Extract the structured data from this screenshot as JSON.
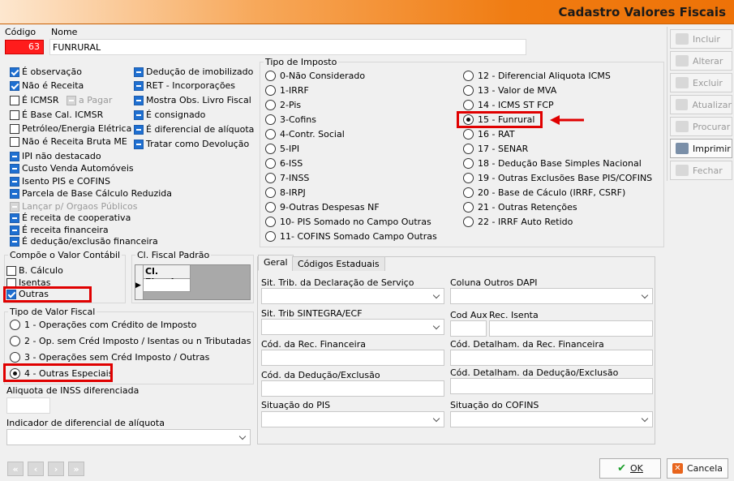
{
  "window": {
    "title": "Cadastro Valores Fiscais"
  },
  "header": {
    "codigo_label": "Código",
    "codigo_value": "63",
    "nome_label": "Nome",
    "nome_value": "FUNRURAL"
  },
  "flags_left": [
    {
      "label": "É observação",
      "state": "checked"
    },
    {
      "label": "Não é Receita",
      "state": "checked"
    },
    {
      "label": "É ICMSR",
      "state": "unchecked"
    },
    {
      "label": "É Base Cal. ICMSR",
      "state": "unchecked"
    },
    {
      "label": "Petróleo/Energia Elétrica",
      "state": "unchecked"
    },
    {
      "label": "Não é Receita Bruta ME",
      "state": "unchecked"
    },
    {
      "label": "IPI não destacado",
      "state": "indeterminate"
    },
    {
      "label": "Custo Venda Automóveis",
      "state": "indeterminate"
    },
    {
      "label": "Isento PIS e COFINS",
      "state": "indeterminate"
    },
    {
      "label": "Parcela de Base Cálculo Reduzida",
      "state": "indeterminate"
    },
    {
      "label": "Lançar p/ Orgaos Públicos",
      "state": "disabled"
    },
    {
      "label": "É receita de cooperativa",
      "state": "indeterminate"
    },
    {
      "label": "É receita financeira",
      "state": "indeterminate"
    },
    {
      "label": "É dedução/exclusão financeira",
      "state": "indeterminate"
    }
  ],
  "a_pagar": {
    "label": "a Pagar"
  },
  "flags_mid": [
    {
      "label": "Dedução de imobilizado"
    },
    {
      "label": "RET - Incorporações"
    },
    {
      "label": "Mostra Obs. Livro Fiscal"
    },
    {
      "label": "É consignado"
    },
    {
      "label": "É diferencial de alíquota"
    },
    {
      "label": "Tratar como Devolução"
    }
  ],
  "tipo_imposto": {
    "title": "Tipo de Imposto",
    "selected": "15 - Funrural",
    "col1": [
      "0-Não Considerado",
      "1-IRRF",
      "2-Pis",
      "3-Cofins",
      "4-Contr. Social",
      "5-IPI",
      "6-ISS",
      "7-INSS",
      "8-IRPJ",
      "9-Outras Despesas NF",
      "10- PIS Somado no Campo Outras",
      "11- COFINS Somado Campo Outras"
    ],
    "col2": [
      "12 - Diferencial Aliquota ICMS",
      "13 - Valor de MVA",
      "14 - ICMS ST FCP",
      "15 - Funrural",
      "16 - RAT",
      "17 - SENAR",
      "18 - Dedução Base Simples Nacional",
      "19 - Outras Exclusões Base PIS/COFINS",
      "20 - Base de Cáculo (IRRF, CSRF)",
      "21 - Outras Retenções",
      "22 - IRRF Auto Retido"
    ]
  },
  "compoe": {
    "title": "Compõe o Valor Contábil",
    "items": [
      {
        "label": "B. Cálculo",
        "state": "unchecked"
      },
      {
        "label": "Isentas",
        "state": "unchecked"
      },
      {
        "label": "Outras",
        "state": "checked"
      }
    ]
  },
  "cl_fiscal": {
    "title": "Cl. Fiscal Padrão",
    "column": "Cl. Fiscal"
  },
  "tipo_valor": {
    "title": "Tipo de Valor Fiscal",
    "selected": "4 - Outras Especiais",
    "options": [
      "1 - Operações com Crédito de Imposto",
      "2 - Op. sem Créd Imposto / Isentas ou n Tributadas",
      "3 - Operações sem Créd Imposto / Outras",
      "4 - Outras Especiais"
    ]
  },
  "aliquota_inss": {
    "label": "Aliquota de INSS diferenciada",
    "value": ""
  },
  "indicador_dif": {
    "label": "Indicador de diferencial de alíquota",
    "value": ""
  },
  "tabs": [
    "Geral",
    "Códigos Estaduais"
  ],
  "geral": {
    "sit_trib_decl": "Sit. Trib. da Declaração de Serviço",
    "coluna_outros_dapi": "Coluna Outros DAPI",
    "sit_trib_sintegra": "Sit. Trib SINTEGRA/ECF",
    "cod_aux": "Cod Aux",
    "rec_isenta": "Rec. Isenta",
    "cod_rec_fin": "Cód. da Rec. Financeira",
    "cod_det_rec_fin": "Cód. Detalham. da Rec. Financeira",
    "cod_deducao": "Cód. da Dedução/Exclusão",
    "cod_det_deducao": "Cód. Detalham. da Dedução/Exclusão",
    "situacao_pis": "Situação do PIS",
    "situacao_cofins": "Situação do COFINS"
  },
  "toolbar": {
    "incluir": "Incluir",
    "alterar": "Alterar",
    "excluir": "Excluir",
    "atualizar": "Atualizar",
    "procurar": "Procurar",
    "imprimir": "Imprimir",
    "fechar": "Fechar"
  },
  "footer": {
    "ok": "OK",
    "cancela": "Cancela"
  },
  "colors": {
    "accent_orange": "#ee7207",
    "highlight_red": "#e00000",
    "check_blue": "#1e6fd1"
  }
}
